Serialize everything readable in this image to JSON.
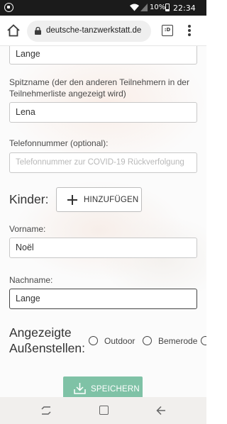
{
  "status_bar": {
    "battery": "10%",
    "time": "22:34"
  },
  "browser": {
    "url": "deutsche-tanzwerkstatt.de",
    "tabs_label": ":D"
  },
  "form": {
    "prev_lastname_value": "Lange",
    "nickname_label": "Spitzname (der den anderen Teilnehmern in der Teilnehmerliste angezeigt wird)",
    "nickname_value": "Lena",
    "phone_label": "Telefonnummer (optional):",
    "phone_placeholder": "Telefonnummer zur COVID-19 Rückverfolgung",
    "children_label": "Kinder:",
    "add_button_label": "HINZUFÜGEN",
    "firstname_label": "Vorname:",
    "firstname_value": "Noël",
    "lastname_label": "Nachname:",
    "lastname_value": "Lange",
    "venues_label_line1": "Angezeigte",
    "venues_label_line2": "Außenstellen:",
    "venues": [
      "Outdoor",
      "Bemerode"
    ],
    "save_button_label": "SPEICHERN"
  }
}
